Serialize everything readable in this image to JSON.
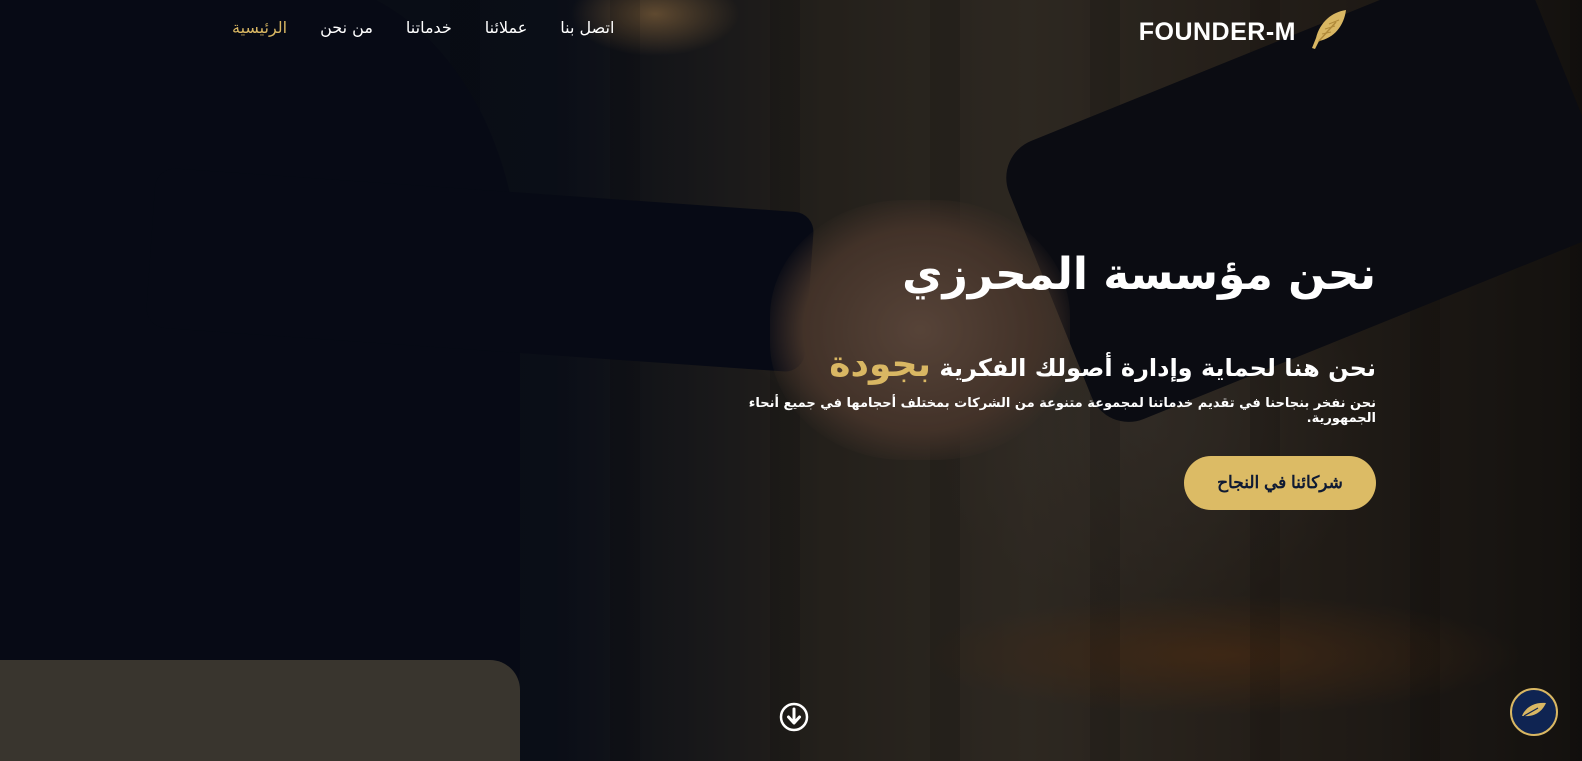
{
  "brand": {
    "name": "FOUNDER-M",
    "logo_icon": "feather-icon",
    "accent_color": "#d9b763"
  },
  "nav": {
    "items": [
      {
        "label": "الرئيسية",
        "active": true
      },
      {
        "label": "من نحن",
        "active": false
      },
      {
        "label": "خدماتنا",
        "active": false
      },
      {
        "label": "عملائنا",
        "active": false
      },
      {
        "label": "اتصل بنا",
        "active": false
      }
    ]
  },
  "hero": {
    "title": "نحن مؤسسة المحرزي",
    "subtitle_prefix": "نحن هنا لحماية وإدارة أصولك الفكرية",
    "subtitle_accent": "بجودة",
    "description": "نحن نفخر بنجاحنا في تقديم خدماتنا لمجموعة متنوعة من الشركات بمختلف أحجامها في جميع أنحاء الجمهورية.",
    "cta_label": "شركائنا في النجاح",
    "cta_color": "#dcbb65"
  },
  "icons": {
    "scroll": "arrow-down-circle-icon",
    "floating": "feather-icon"
  }
}
